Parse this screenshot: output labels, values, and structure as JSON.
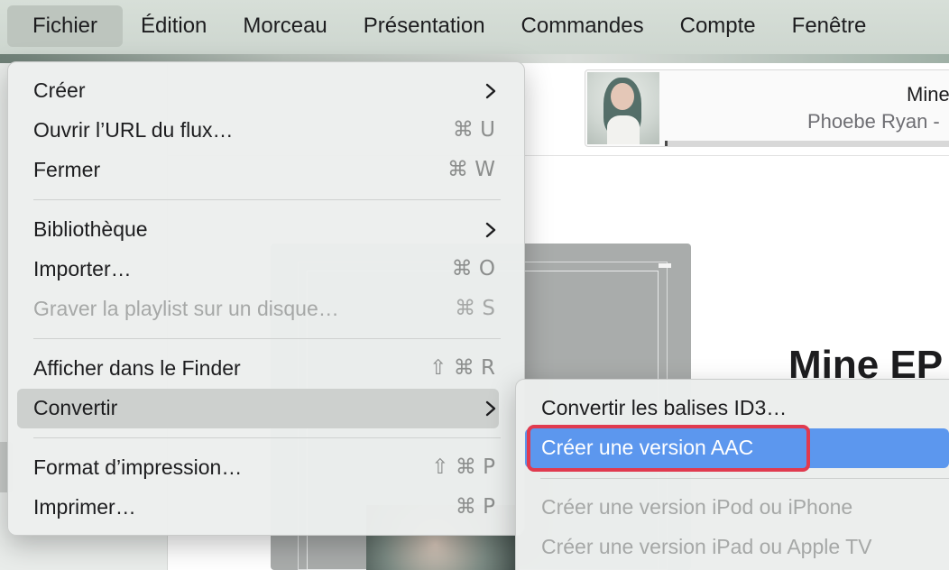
{
  "menubar": {
    "items": [
      "Fichier",
      "Édition",
      "Morceau",
      "Présentation",
      "Commandes",
      "Compte",
      "Fenêtre"
    ]
  },
  "now_playing": {
    "title": "Mine",
    "artist": "Phoebe Ryan -",
    "progress": 0.01
  },
  "album": {
    "title": "Mine EP"
  },
  "file_menu": {
    "items": [
      {
        "label": "Créer",
        "submenu": true
      },
      {
        "label": "Ouvrir l’URL du flux…",
        "shortcut": "⌘ U"
      },
      {
        "label": "Fermer",
        "shortcut": "⌘ W"
      },
      {
        "label": "Bibliothèque",
        "submenu": true
      },
      {
        "label": "Importer…",
        "shortcut": "⌘ O"
      },
      {
        "label": "Graver la playlist sur un disque…",
        "shortcut": "⌘ S",
        "disabled": true
      },
      {
        "label": "Afficher dans le Finder",
        "shortcut": "⇧ ⌘ R"
      },
      {
        "label": "Convertir",
        "submenu": true,
        "highlighted": true
      },
      {
        "label": "Format d’impression…",
        "shortcut": "⇧ ⌘ P"
      },
      {
        "label": "Imprimer…",
        "shortcut": "⌘ P"
      }
    ]
  },
  "convert_submenu": {
    "items": [
      {
        "label": "Convertir les balises ID3…"
      },
      {
        "label": "Créer une version AAC",
        "selected": true
      },
      {
        "label": "Créer une version iPod ou iPhone",
        "disabled": true
      },
      {
        "label": "Créer une version iPad ou Apple TV",
        "disabled": true
      }
    ]
  },
  "colors": {
    "selection": "#5c97ee",
    "annotation_outline": "#e03a4f"
  },
  "icons": {
    "submenu_indicator": "chevron-right-icon"
  }
}
